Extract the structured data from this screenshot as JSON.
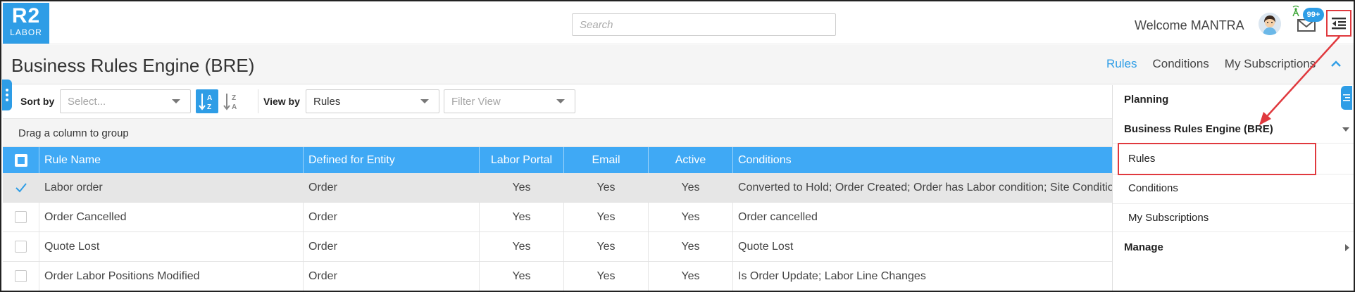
{
  "app": {
    "logo_top": "R2",
    "logo_bottom": "LABOR",
    "search_placeholder": "Search",
    "welcome": "Welcome MANTRA",
    "mail_badge": "99+"
  },
  "page": {
    "title": "Business Rules Engine (BRE)",
    "tabs": [
      {
        "label": "Rules",
        "active": true
      },
      {
        "label": "Conditions",
        "active": false
      },
      {
        "label": "My Subscriptions",
        "active": false
      }
    ]
  },
  "toolbar": {
    "sort_by_label": "Sort by",
    "sort_select_placeholder": "Select...",
    "view_by_label": "View by",
    "view_select_value": "Rules",
    "filter_placeholder": "Filter View"
  },
  "group_area_text": "Drag a column to group",
  "grid": {
    "headers": [
      "Rule Name",
      "Defined for Entity",
      "Labor Portal",
      "Email",
      "Active",
      "Conditions"
    ],
    "rows": [
      {
        "checked": true,
        "name": "Labor order",
        "entity": "Order",
        "portal": "Yes",
        "email": "Yes",
        "active": "Yes",
        "conditions": "Converted to Hold; Order Created; Order has Labor condition; Site Condition"
      },
      {
        "checked": false,
        "name": "Order Cancelled",
        "entity": "Order",
        "portal": "Yes",
        "email": "Yes",
        "active": "Yes",
        "conditions": "Order cancelled"
      },
      {
        "checked": false,
        "name": "Quote Lost",
        "entity": "Order",
        "portal": "Yes",
        "email": "Yes",
        "active": "Yes",
        "conditions": "Quote Lost"
      },
      {
        "checked": false,
        "name": "Order Labor Positions Modified",
        "entity": "Order",
        "portal": "Yes",
        "email": "Yes",
        "active": "Yes",
        "conditions": "Is Order Update; Labor Line Changes"
      }
    ]
  },
  "sidepanel": {
    "planning": "Planning",
    "bre": "Business Rules Engine (BRE)",
    "rules": "Rules",
    "conditions": "Conditions",
    "subscriptions": "My Subscriptions",
    "manage": "Manage"
  },
  "colors": {
    "accent": "#2e9de6",
    "grid_header": "#3fa9f5",
    "highlight": "#e0393e"
  }
}
